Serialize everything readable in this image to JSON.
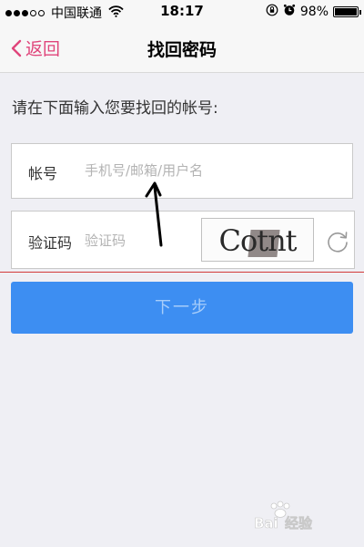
{
  "status_bar": {
    "carrier": "中国联通",
    "time": "18:17",
    "battery_text": "98%",
    "battery_level": 0.98,
    "signal_bars_filled": 3,
    "signal_bars_total": 5
  },
  "nav": {
    "back_label": "返回",
    "title": "找回密码",
    "accent_color": "#e0457b"
  },
  "form": {
    "prompt": "请在下面输入您要找回的帐号:",
    "account_label": "帐号",
    "account_placeholder": "手机号/邮箱/用户名",
    "account_value": "",
    "captcha_label": "验证码",
    "captcha_placeholder": "验证码",
    "captcha_value": "",
    "captcha_image_text": "Cotnt",
    "next_button_label": "下一步",
    "next_button_color": "#3d8ef2"
  },
  "icons": {
    "back": "chevron-left-icon",
    "refresh": "refresh-icon",
    "wifi": "wifi-icon",
    "lock_rotation": "rotation-lock-icon",
    "alarm": "alarm-icon"
  }
}
